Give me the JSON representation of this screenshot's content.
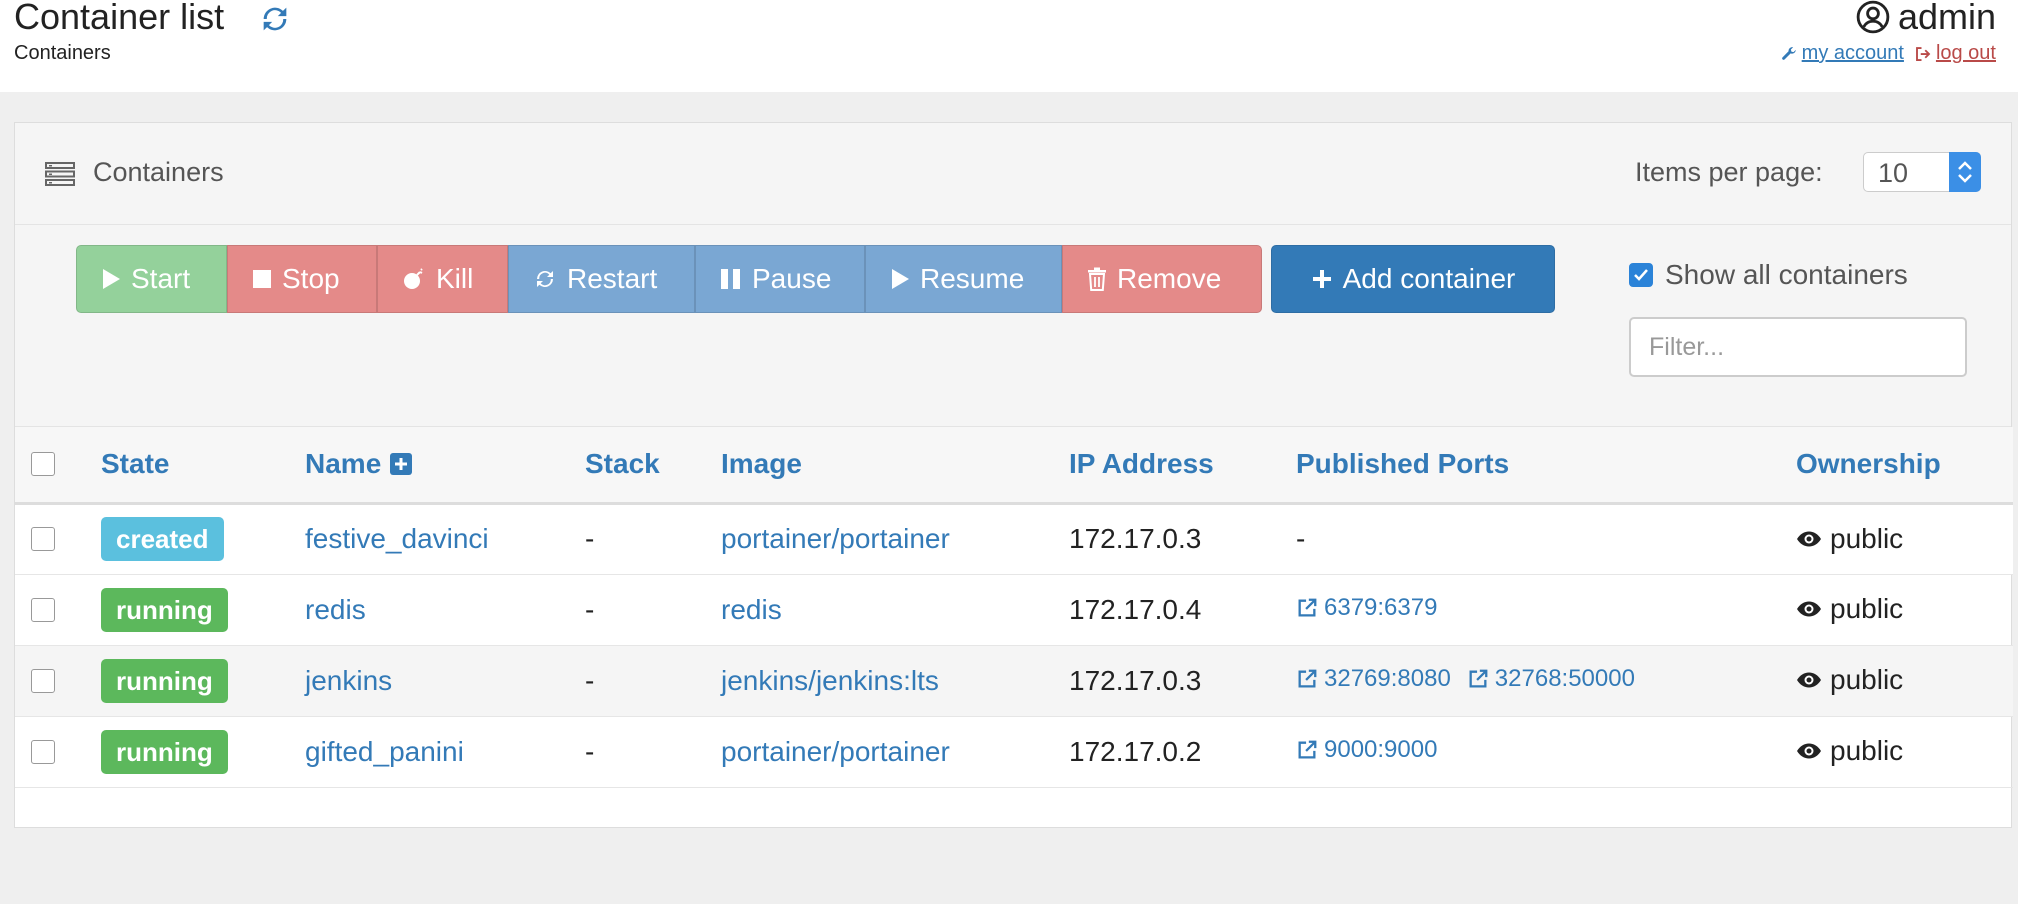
{
  "header": {
    "title": "Container list",
    "breadcrumb": "Containers",
    "username": "admin",
    "my_account": "my account",
    "logout": "log out"
  },
  "panel": {
    "title": "Containers",
    "items_per_page_label": "Items per page:",
    "items_per_page_value": "10"
  },
  "toolbar": {
    "start": "Start",
    "stop": "Stop",
    "kill": "Kill",
    "restart": "Restart",
    "pause": "Pause",
    "resume": "Resume",
    "remove": "Remove",
    "add": "Add container",
    "show_all": "Show all containers",
    "filter_placeholder": "Filter..."
  },
  "table": {
    "columns": [
      "State",
      "Name",
      "Stack",
      "Image",
      "IP Address",
      "Published Ports",
      "Ownership"
    ],
    "rows": [
      {
        "state": "created",
        "name": "festive_davinci",
        "stack": "-",
        "image": "portainer/portainer",
        "ip": "172.17.0.3",
        "ports": [],
        "ports_text": "-",
        "ownership": "public"
      },
      {
        "state": "running",
        "name": "redis",
        "stack": "-",
        "image": "redis",
        "ip": "172.17.0.4",
        "ports": [
          "6379:6379"
        ],
        "ports_text": "",
        "ownership": "public"
      },
      {
        "state": "running",
        "name": "jenkins",
        "stack": "-",
        "image": "jenkins/jenkins:lts",
        "ip": "172.17.0.3",
        "ports": [
          "32769:8080",
          "32768:50000"
        ],
        "ports_text": "",
        "ownership": "public"
      },
      {
        "state": "running",
        "name": "gifted_panini",
        "stack": "-",
        "image": "portainer/portainer",
        "ip": "172.17.0.2",
        "ports": [
          "9000:9000"
        ],
        "ports_text": "",
        "ownership": "public"
      }
    ]
  },
  "colors": {
    "primary": "#337ab7",
    "success": "#5cb85c",
    "info": "#5bc0de",
    "danger_light": "#e48a89",
    "success_light": "#94d19b",
    "primary_light": "#7aa7d3"
  },
  "icons": {
    "refresh": "refresh-icon",
    "user": "user-circle-icon",
    "wrench": "wrench-icon",
    "logout": "sign-out-icon",
    "list": "list-icon",
    "play": "play-icon",
    "stop": "stop-icon",
    "bomb": "bomb-icon",
    "pause": "pause-icon",
    "trash": "trash-icon",
    "plus": "plus-icon",
    "external": "external-link-icon",
    "eye": "eye-icon"
  }
}
